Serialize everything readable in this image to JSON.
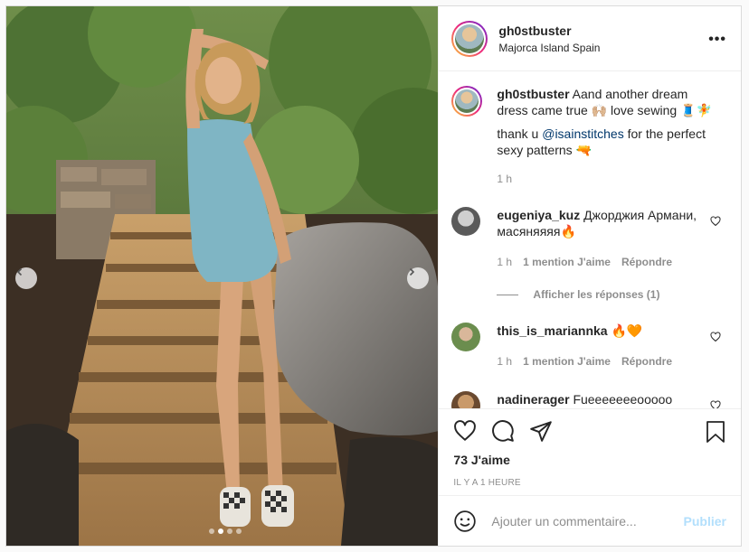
{
  "header": {
    "username": "gh0stbuster",
    "location": "Majorca Island Spain",
    "more_label": "•••"
  },
  "caption": {
    "username": "gh0stbuster",
    "text1": "Aand another dream dress came true 🙌🏼 love sewing 🧵🧚",
    "text2_prefix": "thank u ",
    "mention": "@isainstitches",
    "text2_suffix": " for the perfect sexy patterns 🔫",
    "time": "1 h"
  },
  "comments": [
    {
      "username": "eugeniya_kuz",
      "text": "Джорджия Армани, масяняяяя🔥",
      "time": "1 h",
      "likes": "1 mention J'aime",
      "reply": "Répondre",
      "view_replies": "Afficher les réponses (1)"
    },
    {
      "username": "this_is_mariannka",
      "text": "🔥🧡",
      "time": "1 h",
      "likes": "1 mention J'aime",
      "reply": "Répondre"
    },
    {
      "username": "nadinerager",
      "text": "Fueeeeeeeooooo"
    }
  ],
  "actions": {
    "like_icon": "heart-icon",
    "comment_icon": "comment-icon",
    "share_icon": "paper-plane-icon",
    "save_icon": "bookmark-icon",
    "likes": "73 J'aime",
    "timestamp": "IL Y A 1 HEURE"
  },
  "add_comment": {
    "placeholder": "Ajouter un commentaire...",
    "publish": "Publier",
    "emoji_icon": "smiley-icon"
  },
  "carousel": {
    "current": 2,
    "total": 4
  },
  "colors": {
    "accent": "#0095f6",
    "publish_disabled": "#b2dffc",
    "muted": "#8e8e8e",
    "dress": "#7fb5c4"
  }
}
